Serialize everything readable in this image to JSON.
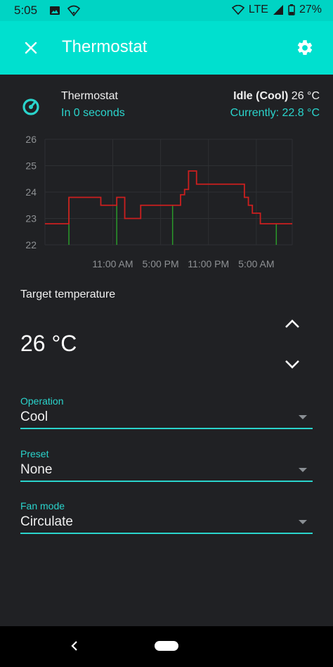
{
  "status_bar": {
    "time": "5:05",
    "network": "LTE",
    "battery": "27%"
  },
  "app_bar": {
    "title": "Thermostat",
    "close_icon": "close-icon",
    "settings_icon": "gear-icon"
  },
  "entity": {
    "name": "Thermostat",
    "last_changed": "In 0 seconds",
    "state_bold": "Idle (Cool)",
    "state_temp": "26 °C",
    "current": "Currently: 22.8 °C",
    "icon": "thermostat-dial-icon"
  },
  "chart_data": {
    "type": "line",
    "x_tick_labels": [
      "11:00 AM",
      "5:00 PM",
      "11:00 PM",
      "5:00 AM"
    ],
    "y_tick_labels": [
      "26",
      "25",
      "24",
      "23",
      "22"
    ],
    "ylim": [
      22,
      26
    ],
    "grid": true,
    "x_hours": [
      0,
      3,
      4,
      5,
      6,
      7,
      8,
      9,
      10,
      11,
      12,
      13,
      14,
      15,
      16,
      17,
      17.5,
      18,
      19,
      20,
      21,
      22,
      23,
      24,
      25,
      25.5,
      26,
      27,
      28,
      29,
      30,
      31
    ],
    "series": [
      {
        "color": "#cc1f1f",
        "step": true,
        "values": [
          22.8,
          23.8,
          23.8,
          23.8,
          23.8,
          23.5,
          23.5,
          23.8,
          23,
          23,
          23.5,
          23.5,
          23.5,
          23.5,
          23.5,
          23.9,
          24.1,
          24.8,
          24.3,
          24.3,
          24.3,
          24.3,
          24.3,
          24.3,
          23.8,
          23.5,
          23.2,
          22.8,
          22.8,
          22.8,
          22.8,
          22.8
        ]
      }
    ],
    "action_bars": {
      "color": "#2a9a2a",
      "x_hours": [
        3,
        9,
        16,
        29
      ]
    }
  },
  "target": {
    "label": "Target temperature",
    "value": "26 °C"
  },
  "fields": [
    {
      "label": "Operation",
      "value": "Cool"
    },
    {
      "label": "Preset",
      "value": "None"
    },
    {
      "label": "Fan mode",
      "value": "Circulate"
    }
  ],
  "colors": {
    "accent": "#00e0cf",
    "accent_text": "#2ad4cc",
    "background": "#202124",
    "line": "#cc1f1f",
    "action": "#2a9a2a"
  }
}
